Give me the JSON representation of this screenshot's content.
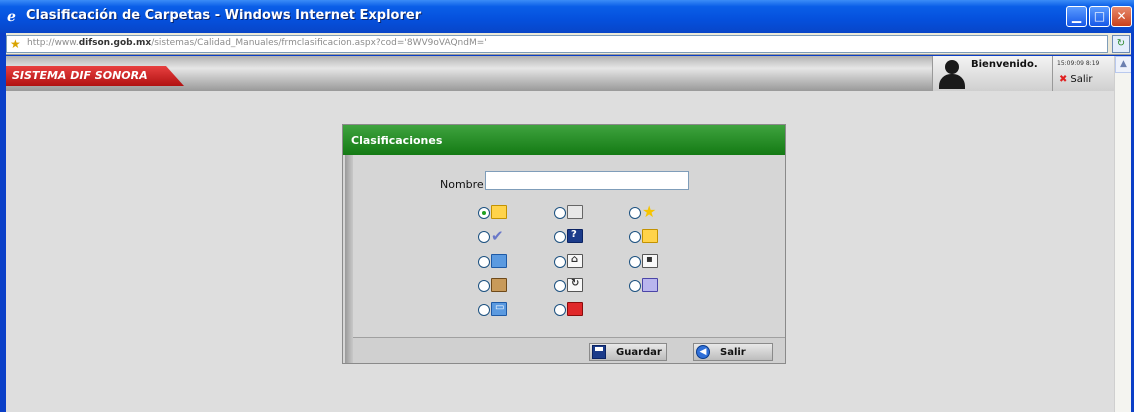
{
  "window": {
    "title": "Clasificación de Carpetas - Windows Internet Explorer",
    "buttons": {
      "minimize": "▁",
      "maximize": "□",
      "close": "✕"
    }
  },
  "address": {
    "url_prefix": "http://www.",
    "url_domain": "difson.gob.mx",
    "url_path": "/sistemas/Calidad_Manuales/frmclasificacion.aspx?cod='8WV9oVAQndM='"
  },
  "header": {
    "system_name": "SISTEMA DIF SONORA",
    "welcome": "Bienvenido.",
    "time": "15:09:09 8:19",
    "logout": "Salir"
  },
  "dialog": {
    "title": "Clasificaciones",
    "name_label": "Nombre:",
    "name_value": "",
    "options": [
      {
        "icon": "yellow-folder-icon",
        "color": "yellow",
        "checked": true
      },
      {
        "icon": "gray-folder-icon",
        "color": "gray",
        "checked": false
      },
      {
        "icon": "star-icon",
        "color": "star",
        "checked": false
      },
      {
        "icon": "checkmark-icon",
        "color": "check",
        "checked": false
      },
      {
        "icon": "help-book-icon",
        "color": "navy",
        "checked": false
      },
      {
        "icon": "locked-folder-icon",
        "color": "yellow",
        "checked": false
      },
      {
        "icon": "blue-folder-icon",
        "color": "blue",
        "checked": false
      },
      {
        "icon": "home-folder-icon",
        "color": "white",
        "checked": false
      },
      {
        "icon": "contact-card-icon",
        "color": "white",
        "checked": false
      },
      {
        "icon": "brown-binder-icon",
        "color": "brown",
        "checked": false
      },
      {
        "icon": "document-arrow-icon",
        "color": "white",
        "checked": false
      },
      {
        "icon": "purple-folder-icon",
        "color": "purple",
        "checked": false
      },
      {
        "icon": "open-book-icon",
        "color": "blue",
        "checked": false
      },
      {
        "icon": "red-folder-icon",
        "color": "red",
        "checked": false
      }
    ],
    "save_label": "Guardar",
    "exit_label": "Salir"
  }
}
